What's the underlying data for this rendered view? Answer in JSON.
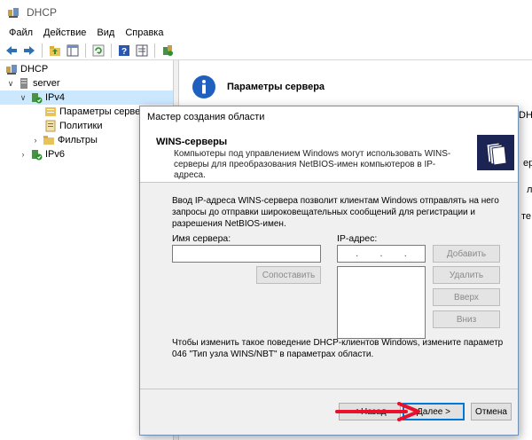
{
  "window": {
    "title": "DHCP"
  },
  "menu": [
    "Файл",
    "Действие",
    "Вид",
    "Справка"
  ],
  "tree": {
    "root": "DHCP",
    "server": "server",
    "ipv4": "IPv4",
    "server_options": "Параметры сервера",
    "policies": "Политики",
    "filters": "Фильтры",
    "ipv6": "IPv6"
  },
  "detail": {
    "heading": "Параметры сервера",
    "peek1": "DHC",
    "peek2": "ера",
    "peek3": "ль",
    "peek4": "те."
  },
  "dialog": {
    "title": "Мастер создания области",
    "header_title": "WINS-серверы",
    "header_desc": "Компьютеры под управлением Windows могут использовать WINS-серверы для преобразования NetBIOS-имен компьютеров в IP-адреса.",
    "intro": "Ввод IP-адреса WINS-сервера позволит клиентам Windows отправлять на него запросы до отправки широковещательных сообщений для регистрации и разрешения NetBIOS-имен.",
    "server_name_label": "Имя сервера:",
    "server_name_value": "",
    "ip_label": "IP-адрес:",
    "ip_value": "    .    .    .    ",
    "resolve_button": "Сопоставить",
    "add_button": "Добавить",
    "remove_button": "Удалить",
    "up_button": "Вверх",
    "down_button": "Вниз",
    "footnote": "Чтобы изменить такое поведение DHCP-клиентов Windows, измените параметр 046 \"Тип узла WINS/NBT\" в параметрах области.",
    "back_button": "< Назад",
    "next_button": "Далее >",
    "cancel_button": "Отмена"
  },
  "colors": {
    "accent": "#0078d7",
    "selection": "#cce8ff",
    "annotation_arrow": "#e8102a",
    "wizard_icon_bg": "#1c2453"
  }
}
